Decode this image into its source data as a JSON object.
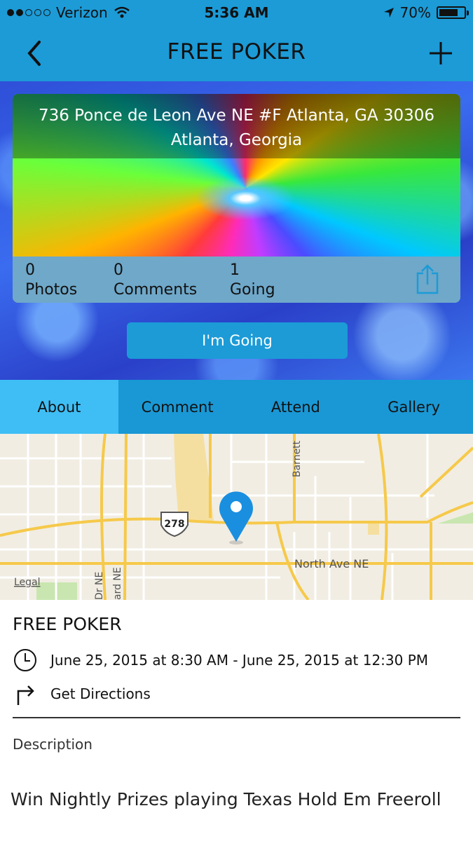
{
  "status_bar": {
    "carrier": "Verizon",
    "time": "5:36 AM",
    "battery": "70%",
    "signal_icon": "signal-dots-icon",
    "wifi_icon": "wifi-icon",
    "location_icon": "location-arrow-icon",
    "battery_level": 0.7
  },
  "nav": {
    "title": "FREE POKER",
    "back_icon": "chevron-left-icon",
    "add_icon": "plus-icon"
  },
  "hero": {
    "address_line1": "736 Ponce de Leon Ave NE #F Atlanta, GA 30306",
    "address_line2": "Atlanta, Georgia",
    "stats": [
      {
        "count": "0",
        "label": "Photos"
      },
      {
        "count": "0",
        "label": "Comments"
      },
      {
        "count": "1",
        "label": "Going"
      }
    ],
    "share_icon": "share-icon",
    "going_button": "I'm Going"
  },
  "tabs": [
    {
      "label": "About",
      "active": true
    },
    {
      "label": "Comment",
      "active": false
    },
    {
      "label": "Attend",
      "active": false
    },
    {
      "label": "Gallery",
      "active": false
    }
  ],
  "map": {
    "route_shield": "278",
    "street_north_ave": "North Ave NE",
    "street_barnett": "Barnett",
    "street_dr": "Dr NE",
    "street_ard": "ard NE",
    "legal": "Legal",
    "pin_icon": "map-pin-icon"
  },
  "details": {
    "title": "FREE POKER",
    "datetime": "June 25, 2015 at 8:30 AM - June 25, 2015 at 12:30 PM",
    "clock_icon": "clock-icon",
    "directions": "Get Directions",
    "directions_icon": "turn-right-arrow-icon",
    "description_label": "Description",
    "description": "Win Nightly Prizes playing Texas Hold Em Freeroll"
  },
  "colors": {
    "nav_blue": "#1c9bd7",
    "tab_active": "#3fbef5",
    "stats_bar": "#6fa8c9",
    "pin_blue": "#1a8fe0"
  }
}
